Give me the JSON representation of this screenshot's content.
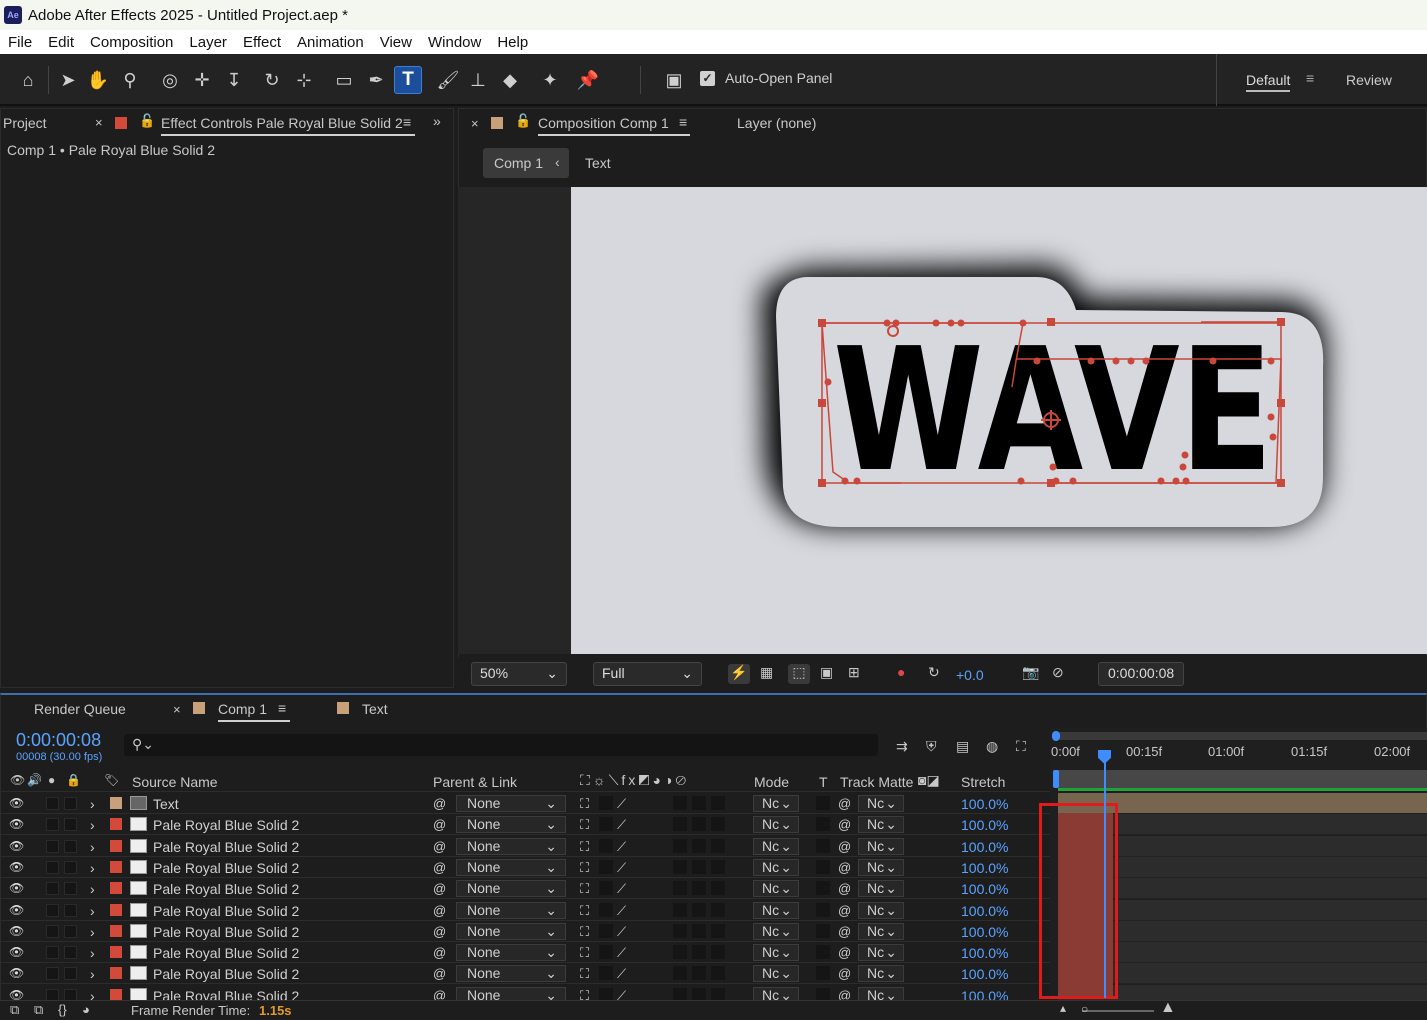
{
  "window": {
    "title": "Adobe After Effects 2025 - Untitled Project.aep *",
    "app_icon": "Ae"
  },
  "menu": [
    "File",
    "Edit",
    "Composition",
    "Layer",
    "Effect",
    "Animation",
    "View",
    "Window",
    "Help"
  ],
  "toolbar": {
    "auto_open_label": "Auto-Open Panel",
    "workspace_default": "Default",
    "workspace_review": "Review",
    "auto_open_checked": true,
    "tools": [
      "home-icon",
      "selection-icon",
      "hand-icon",
      "zoom-icon",
      "orbit-icon",
      "pan-icon",
      "dolly-icon",
      "rotate-icon",
      "anchor-icon",
      "rectangle-icon",
      "pen-icon",
      "type-icon",
      "brush-icon",
      "clone-stamp-icon",
      "eraser-icon",
      "roto-brush-icon",
      "puppet-pin-icon"
    ]
  },
  "left_panel": {
    "project_tab": "Project",
    "effect_tab": "Effect Controls Pale Royal Blue Solid 2",
    "breadcrumb": "Comp 1 • Pale Royal Blue Solid 2"
  },
  "comp_panel": {
    "tab": "Composition Comp 1",
    "layer_tab": "Layer (none)",
    "crumb_comp": "Comp 1",
    "crumb_text": "Text",
    "artwork_text": "WAVE"
  },
  "viewer_bar": {
    "zoom": "50%",
    "quality": "Full",
    "exposure": "+0.0",
    "timecode": "0:00:00:08"
  },
  "timeline": {
    "tabs": {
      "render_queue": "Render Queue",
      "comp": "Comp 1",
      "text": "Text"
    },
    "current_time": "0:00:00:08",
    "frame_info": "00008 (30.00 fps)",
    "columns": {
      "source_name": "Source Name",
      "parent_link": "Parent & Link",
      "mode": "Mode",
      "t": "T",
      "track_matte": "Track Matte",
      "stretch": "Stretch"
    },
    "ruler": [
      "0:00f",
      "00:15f",
      "01:00f",
      "01:15f",
      "02:00f"
    ],
    "layers": [
      {
        "name": "Text",
        "label_color": "#c8a07a",
        "parent": "None",
        "mode": "Nc",
        "matte": "Nc",
        "stretch": "100.0%"
      },
      {
        "name": "Pale Royal Blue Solid 2",
        "label_color": "#d24a3a",
        "parent": "None",
        "mode": "Nc",
        "matte": "Nc",
        "stretch": "100.0%"
      },
      {
        "name": "Pale Royal Blue Solid 2",
        "label_color": "#d24a3a",
        "parent": "None",
        "mode": "Nc",
        "matte": "Nc",
        "stretch": "100.0%"
      },
      {
        "name": "Pale Royal Blue Solid 2",
        "label_color": "#d24a3a",
        "parent": "None",
        "mode": "Nc",
        "matte": "Nc",
        "stretch": "100.0%"
      },
      {
        "name": "Pale Royal Blue Solid 2",
        "label_color": "#d24a3a",
        "parent": "None",
        "mode": "Nc",
        "matte": "Nc",
        "stretch": "100.0%"
      },
      {
        "name": "Pale Royal Blue Solid 2",
        "label_color": "#d24a3a",
        "parent": "None",
        "mode": "Nc",
        "matte": "Nc",
        "stretch": "100.0%"
      },
      {
        "name": "Pale Royal Blue Solid 2",
        "label_color": "#d24a3a",
        "parent": "None",
        "mode": "Nc",
        "matte": "Nc",
        "stretch": "100.0%"
      },
      {
        "name": "Pale Royal Blue Solid 2",
        "label_color": "#d24a3a",
        "parent": "None",
        "mode": "Nc",
        "matte": "Nc",
        "stretch": "100.0%"
      },
      {
        "name": "Pale Royal Blue Solid 2",
        "label_color": "#d24a3a",
        "parent": "None",
        "mode": "Nc",
        "matte": "Nc",
        "stretch": "100.0%"
      },
      {
        "name": "Pale Royal Blue Solid 2",
        "label_color": "#d24a3a",
        "parent": "None",
        "mode": "Nc",
        "matte": "Nc",
        "stretch": "100.0%"
      }
    ],
    "footer": {
      "label": "Frame Render Time:",
      "value": "1.15s"
    }
  }
}
